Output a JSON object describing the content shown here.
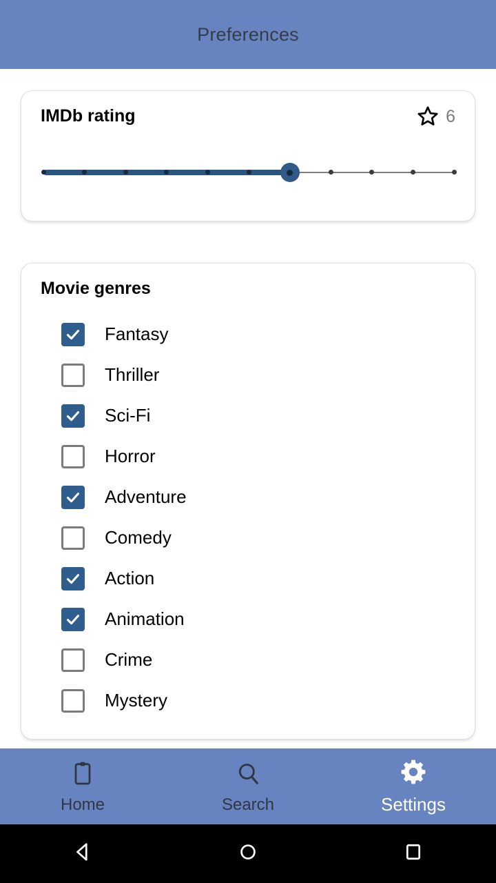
{
  "appbar": {
    "title": "Preferences"
  },
  "rating_card": {
    "title": "IMDb rating",
    "star_icon": "star-outline-icon",
    "value": "6",
    "slider": {
      "min": 0,
      "max": 10,
      "value": 6,
      "ticks": 11
    }
  },
  "genres_card": {
    "title": "Movie genres",
    "items": [
      {
        "label": "Fantasy",
        "checked": true
      },
      {
        "label": "Thriller",
        "checked": false
      },
      {
        "label": "Sci-Fi",
        "checked": true
      },
      {
        "label": "Horror",
        "checked": false
      },
      {
        "label": "Adventure",
        "checked": true
      },
      {
        "label": "Comedy",
        "checked": false
      },
      {
        "label": "Action",
        "checked": true
      },
      {
        "label": "Animation",
        "checked": true
      },
      {
        "label": "Crime",
        "checked": false
      },
      {
        "label": "Mystery",
        "checked": false
      }
    ]
  },
  "bottom_nav": {
    "items": [
      {
        "label": "Home",
        "icon": "clipboard-icon",
        "active": false
      },
      {
        "label": "Search",
        "icon": "search-icon",
        "active": false
      },
      {
        "label": "Settings",
        "icon": "gear-icon",
        "active": true
      }
    ]
  },
  "system_nav": {
    "items": [
      {
        "name": "back-button",
        "icon": "triangle-left-icon"
      },
      {
        "name": "home-button",
        "icon": "circle-icon"
      },
      {
        "name": "recents-button",
        "icon": "square-icon"
      }
    ]
  },
  "colors": {
    "accent": "#6884c0",
    "checkbox_checked": "#2f5d8e",
    "slider_fill": "#2b5480",
    "slider_thumb": "#31598a"
  }
}
